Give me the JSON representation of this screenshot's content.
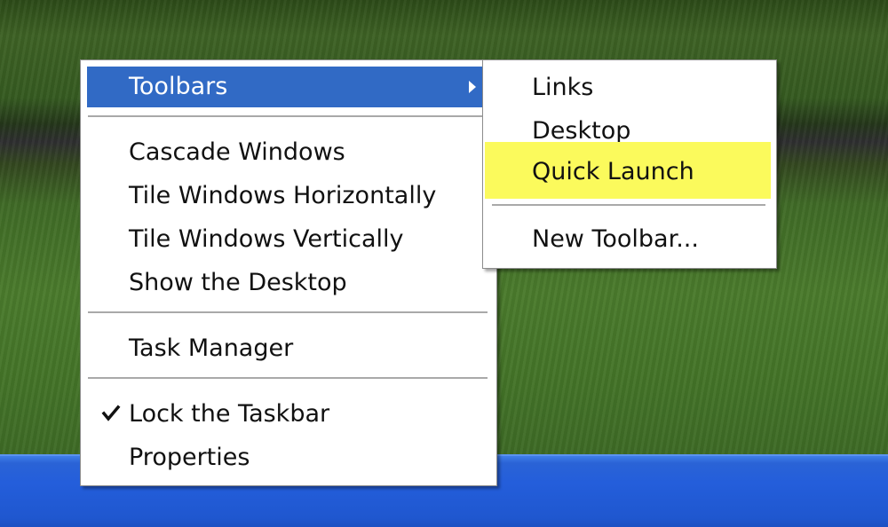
{
  "context_menu": {
    "toolbars_label": "Toolbars",
    "cascade_label": "Cascade Windows",
    "tile_horizontal_label": "Tile Windows Horizontally",
    "tile_vertical_label": "Tile Windows Vertically",
    "show_desktop_label": "Show the Desktop",
    "task_manager_label": "Task Manager",
    "lock_taskbar_label": "Lock the Taskbar",
    "lock_taskbar_checked": true,
    "properties_label": "Properties"
  },
  "toolbars_submenu": {
    "links_label": "Links",
    "desktop_label": "Desktop",
    "quick_launch_label": "Quick Launch",
    "new_toolbar_label": "New Toolbar..."
  },
  "colors": {
    "selection_blue": "#316ac5",
    "highlight_yellow": "#fbfa5c",
    "taskbar_blue": "#245edb"
  }
}
